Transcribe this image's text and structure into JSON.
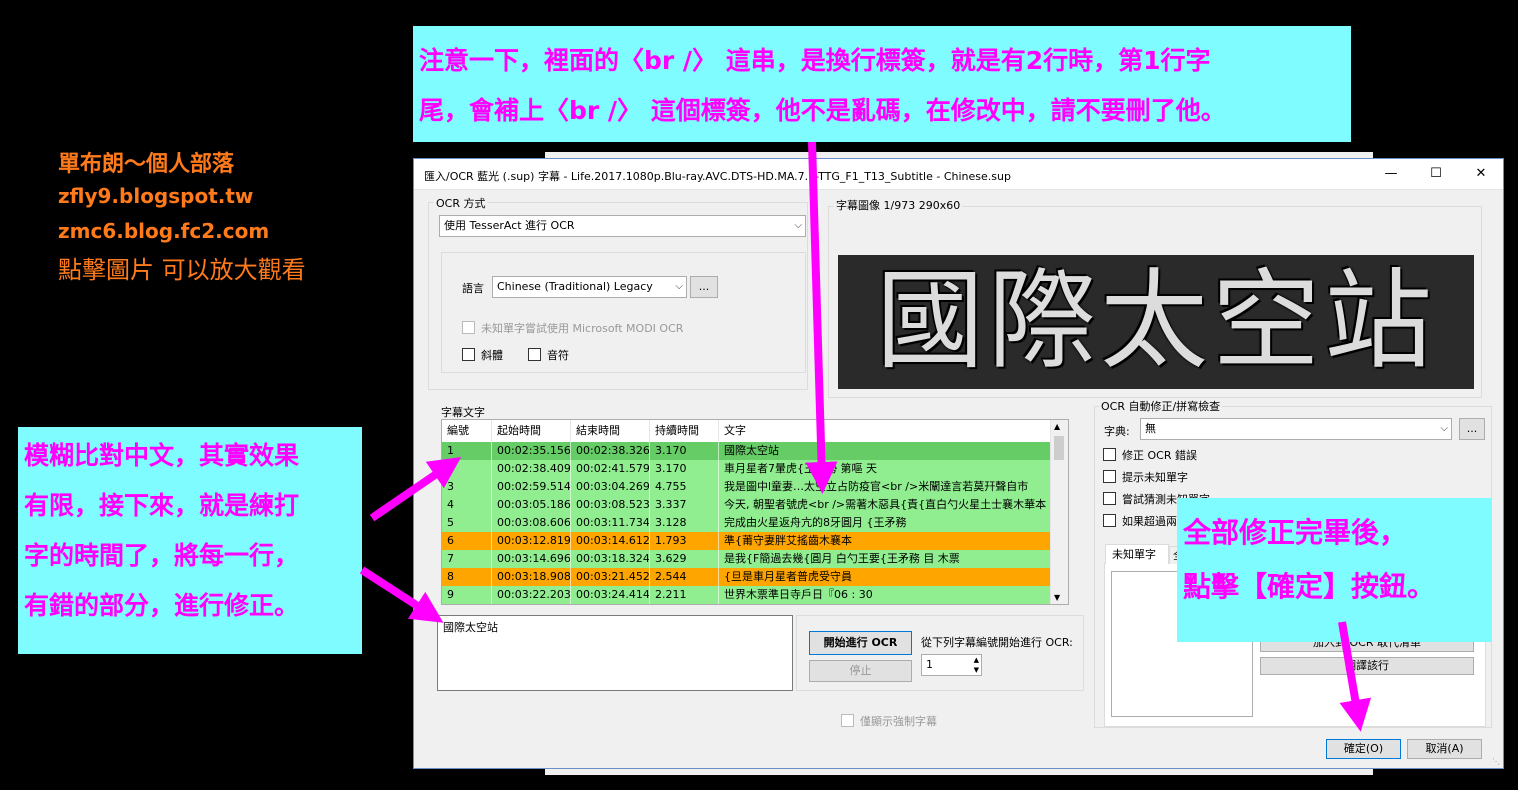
{
  "credit": {
    "line1": "單布朗～個人部落",
    "line2": "zfly9.blogspot.tw",
    "line3": "zmc6.blog.fc2.com",
    "line4": "點擊圖片 可以放大觀看"
  },
  "notes": {
    "top": [
      "注意一下，裡面的〈br /〉 這串，是換行標簽，就是有2行時，第1行字",
      "尾，會補上〈br /〉 這個標簽，他不是亂碼，在修改中，請不要刪了他。"
    ],
    "left": [
      "模糊比對中文，其實效果",
      "有限，接下來，就是練打",
      "字的時間了，將每一行，",
      "有錯的部分，進行修正。"
    ],
    "right": [
      "全部修正完畢後，",
      "點擊【確定】按鈕。"
    ]
  },
  "window": {
    "title": "匯入/OCR 藍光 (.sup) 字幕 - Life.2017.1080p.Blu-ray.AVC.DTS-HD.MA.7.1-TTG_F1_T13_Subtitle - Chinese.sup",
    "minimize": "—",
    "maximize": "☐",
    "close": "✕"
  },
  "ocr_method": {
    "label": "OCR 方式",
    "value": "使用 TesserAct 進行 OCR",
    "language_label": "語言",
    "language_value": "Chinese (Traditional) Legacy",
    "more_button": "...",
    "modi_option": "未知單字嘗試使用 Microsoft MODI OCR",
    "italic": "斜體",
    "music": "音符"
  },
  "subtitle_image": {
    "label": "字幕圖像 1/973   290x60",
    "text": "國際太空站"
  },
  "subtitle_text": {
    "label": "字幕文字",
    "columns": [
      "編號",
      "起始時間",
      "結束時間",
      "持續時間",
      "文字"
    ],
    "rows": [
      {
        "no": "1",
        "start": "00:02:35.156",
        "end": "00:02:38.326",
        "dur": "3.170",
        "text": "國際太空站",
        "state": "selected"
      },
      {
        "no": "2",
        "start": "00:02:38.409",
        "end": "00:02:41.579",
        "end2": "",
        "dur": "3.170",
        "text": "車月星者7暈虎{王弓勢 第嘔 天",
        "state": "ok"
      },
      {
        "no": "3",
        "start": "00:02:59.514",
        "end": "00:03:04.269",
        "dur": "4.755",
        "text": "我是圖中l童妻…太空立占防疫官<br />米闡達言若莫幵聲自市",
        "state": "ok"
      },
      {
        "no": "4",
        "start": "00:03:05.186",
        "end": "00:03:08.523",
        "dur": "3.337",
        "text": "今天, 朝聖者號虎<br />需著木惡具{責{直白勺火星土士襄木華本",
        "state": "ok"
      },
      {
        "no": "5",
        "start": "00:03:08.606",
        "end": "00:03:11.734",
        "dur": "3.128",
        "text": "完成由火星返舟亢的8牙圓月 {王矛務",
        "state": "ok"
      },
      {
        "no": "6",
        "start": "00:03:12.819",
        "end": "00:03:14.612",
        "dur": "1.793",
        "text": "準{莆守妻胖艾搖齒木襄本",
        "state": "warn"
      },
      {
        "no": "7",
        "start": "00:03:14.696",
        "end": "00:03:18.324",
        "dur": "3.629",
        "text": "是我{F簡過去幾{圓月 白勺王要{王矛務 目 木票",
        "state": "ok"
      },
      {
        "no": "8",
        "start": "00:03:18.908",
        "end": "00:03:21.452",
        "dur": "2.544",
        "text": "{旦是車月星者普虎受守員",
        "state": "warn"
      },
      {
        "no": "9",
        "start": "00:03:22.203",
        "end": "00:03:24.414",
        "dur": "2.211",
        "text": "世界木票準日寺戶日『06 : 30",
        "state": "ok"
      }
    ],
    "current_text": "國際太空站"
  },
  "ocr_controls": {
    "start_button": "開始進行 OCR",
    "stop_button": "停止",
    "from_label": "從下列字幕編號開始進行 OCR:",
    "from_value": "1",
    "forced_only": "僅顯示強制字幕"
  },
  "auto_correct": {
    "label": "OCR 自動修正/拼寫檢查",
    "dictionary_label": "字典:",
    "dictionary_value": "無",
    "more_button": "...",
    "fix_errors": "修正 OCR 錯誤",
    "show_unknown": "提示未知單字",
    "guess_unknown": "嘗試猜測未知單字",
    "if_too_many": "如果超過兩",
    "tab_unknown": "未知單字",
    "tab_all": "全",
    "add_button": "加入到 OCR 取代清單",
    "google_button": "翻譯該行"
  },
  "footer": {
    "ok": "確定(O)",
    "cancel": "取消(A)"
  },
  "colors": {
    "note_bg": "#7ffcff",
    "note_text": "#ff00ff",
    "credit": "#ff7a1a",
    "row_selected": "#66cc66",
    "row_ok": "#90ee90",
    "row_warn": "#ffa500",
    "arrow": "#ff00ff"
  }
}
